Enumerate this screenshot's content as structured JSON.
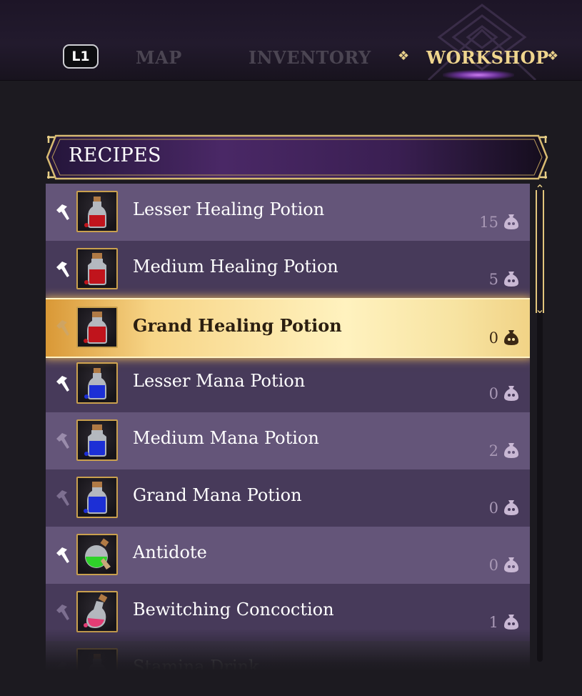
{
  "nav": {
    "button_hint": "L1",
    "tabs": [
      {
        "label": "MAP",
        "active": false
      },
      {
        "label": "INVENTORY",
        "active": false
      },
      {
        "label": "WORKSHOP",
        "active": true
      }
    ],
    "active_marker": "❖"
  },
  "recipes": {
    "title": "RECIPES",
    "items": [
      {
        "name": "Lesser Healing Potion",
        "count": "15",
        "icon": "red-potion-vial-icon",
        "craftable": true,
        "selected": false
      },
      {
        "name": "Medium Healing Potion",
        "count": "5",
        "icon": "red-potion-bottle-icon",
        "craftable": true,
        "selected": false
      },
      {
        "name": "Grand Healing Potion",
        "count": "0",
        "icon": "red-potion-flask-icon",
        "craftable": false,
        "selected": true
      },
      {
        "name": "Lesser Mana Potion",
        "count": "0",
        "icon": "blue-potion-vial-icon",
        "craftable": true,
        "selected": false
      },
      {
        "name": "Medium Mana Potion",
        "count": "2",
        "icon": "blue-potion-bottle-icon",
        "craftable": false,
        "selected": false
      },
      {
        "name": "Grand Mana Potion",
        "count": "0",
        "icon": "blue-potion-flask-icon",
        "craftable": false,
        "selected": false
      },
      {
        "name": "Antidote",
        "count": "0",
        "icon": "green-potion-round-icon",
        "craftable": true,
        "selected": false
      },
      {
        "name": "Bewitching Concoction",
        "count": "1",
        "icon": "pink-potion-jug-icon",
        "craftable": false,
        "selected": false
      },
      {
        "name": "Stamina Drink",
        "count": "",
        "icon": "dark-potion-bottle-icon",
        "craftable": false,
        "selected": false
      }
    ]
  },
  "colors": {
    "accent_gold": "#efd58e",
    "row_light": "#645579",
    "row_dark": "#473a5a",
    "selected_highlight": "#fff2bf",
    "inactive_tab": "#4b4552"
  }
}
